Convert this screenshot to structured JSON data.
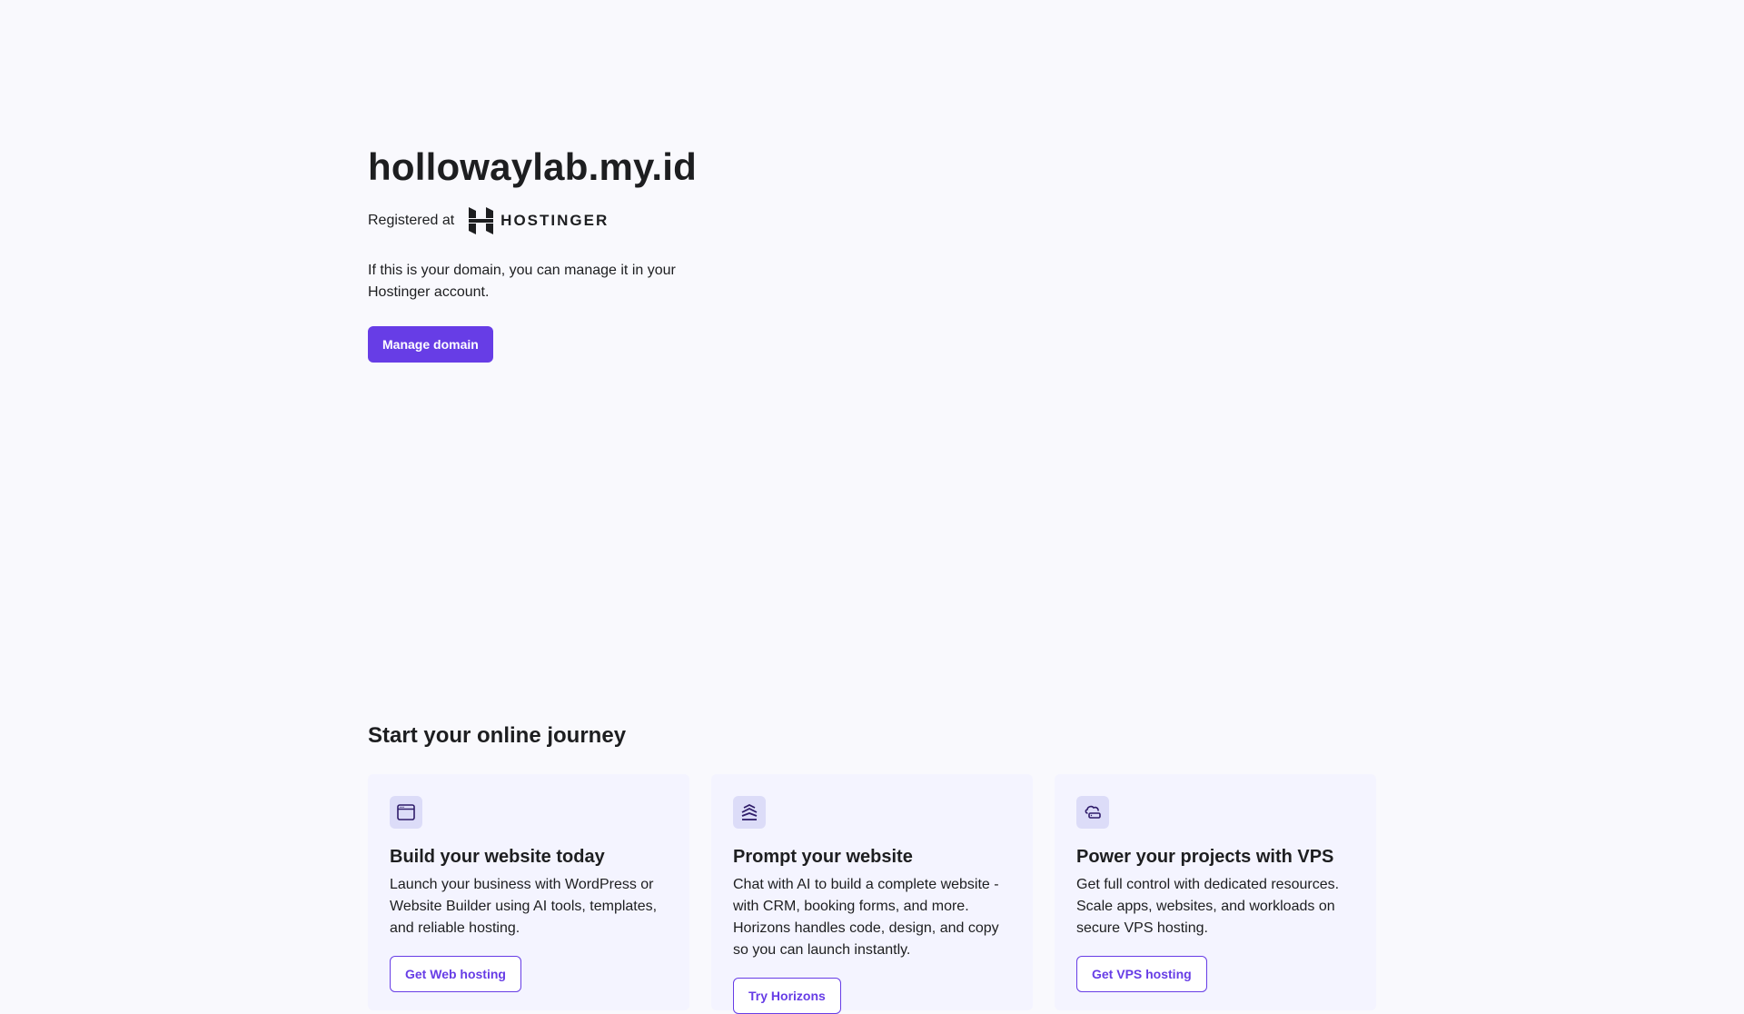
{
  "hero": {
    "domain": "hollowaylab.my.id",
    "registered_label": "Registered at",
    "brand_name": "HOSTINGER",
    "description": "If this is your domain, you can manage it in your Hostinger account.",
    "manage_button": "Manage domain"
  },
  "journey": {
    "title": "Start your online journey",
    "cards": [
      {
        "icon": "browser-window-icon",
        "title": "Build your website today",
        "text": "Launch your business with WordPress or Website Builder using AI tools, templates, and reliable hosting.",
        "button": "Get Web hosting"
      },
      {
        "icon": "horizons-icon",
        "title": "Prompt your website",
        "text": "Chat with AI to build a complete website - with CRM, booking forms, and more. Horizons handles code, design, and copy so you can launch instantly.",
        "button": "Try Horizons"
      },
      {
        "icon": "cloud-server-icon",
        "title": "Power your projects with VPS",
        "text": "Get full control with dedicated resources. Scale apps, websites, and workloads on secure VPS hosting.",
        "button": "Get VPS hosting"
      }
    ]
  },
  "colors": {
    "accent": "#673de6",
    "background": "#f9f9fd",
    "card_background": "#f4f4ff",
    "icon_background": "#dcdcf8",
    "text": "#1d1e20"
  }
}
